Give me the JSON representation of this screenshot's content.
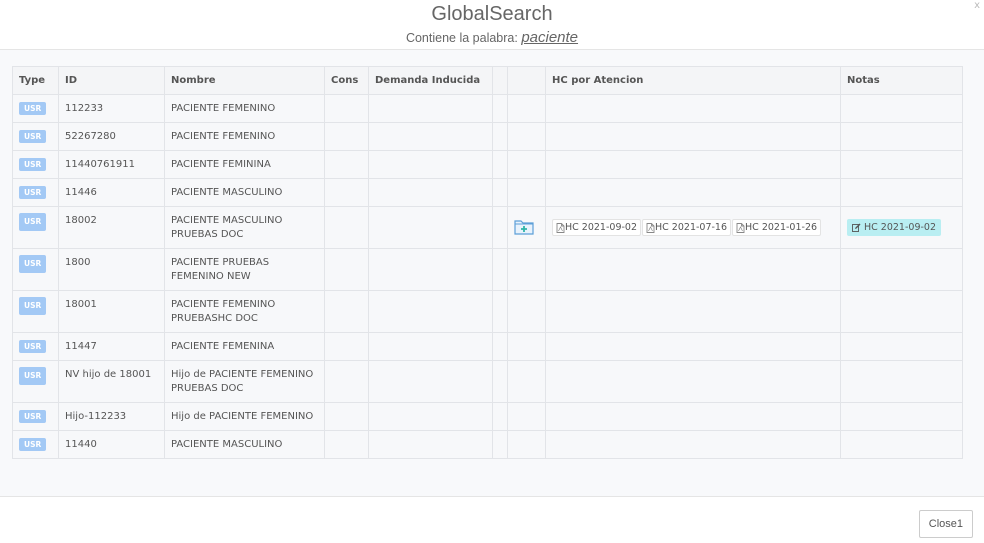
{
  "header": {
    "title": "GlobalSearch",
    "subtitle_prefix": "Contiene la palabra: ",
    "term": "paciente",
    "close": "x"
  },
  "columns": [
    "Type",
    "ID",
    "Nombre",
    "Cons",
    "Demanda Inducida",
    "",
    "",
    "HC por Atencion",
    "Notas"
  ],
  "rows": [
    {
      "type": "USR",
      "id": "112233",
      "nombre": [
        "PACIENTE FEMENINO"
      ]
    },
    {
      "type": "USR",
      "id": "52267280",
      "nombre": [
        "PACIENTE FEMENINO"
      ]
    },
    {
      "type": "USR",
      "id": "11440761911",
      "nombre": [
        "PACIENTE FEMININA"
      ]
    },
    {
      "type": "USR",
      "id": "11446",
      "nombre": [
        "PACIENTE MASCULINO"
      ]
    },
    {
      "type": "USR",
      "id": "18002",
      "nombre": [
        "PACIENTE MASCULINO",
        "PRUEBAS DOC"
      ],
      "icon": "folder-plus-icon",
      "hc": [
        "HC 2021-09-02",
        "HC 2021-07-16",
        "HC 2021-01-26"
      ],
      "nota": "HC 2021-09-02"
    },
    {
      "type": "USR",
      "id": "1800",
      "nombre": [
        "PACIENTE PRUEBAS",
        "FEMENINO NEW"
      ]
    },
    {
      "type": "USR",
      "id": "18001",
      "nombre": [
        "PACIENTE FEMENINO",
        "PRUEBASHC DOC"
      ]
    },
    {
      "type": "USR",
      "id": "11447",
      "nombre": [
        "PACIENTE FEMENINA"
      ]
    },
    {
      "type": "USR",
      "id": "NV hijo de 18001",
      "nombre": [
        "Hijo de PACIENTE FEMENINO",
        "PRUEBAS DOC"
      ]
    },
    {
      "type": "USR",
      "id": "Hijo-112233",
      "nombre": [
        "Hijo de PACIENTE FEMENINO"
      ]
    },
    {
      "type": "USR",
      "id": "11440",
      "nombre": [
        "PACIENTE MASCULINO"
      ]
    }
  ],
  "footer": {
    "close_label": "Close1"
  },
  "colors": {
    "badge": "#a3c9f5",
    "nota": "#b9eef2"
  }
}
